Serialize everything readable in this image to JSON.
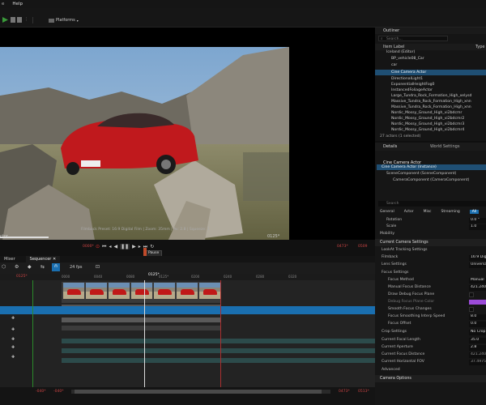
{
  "menu": {
    "help": "Help"
  },
  "toolbar": {
    "platforms_label": "Platforms"
  },
  "viewport": {
    "filmback_info": "Filmback Preset: 16:9 Digital Film | Zoom: 35mm | Av: 2.8 | Squeeze: 1",
    "actor_label": "ctor",
    "frame_readout": "0125*"
  },
  "transport": {
    "start_frame": "0000*",
    "end_frame": "0473*",
    "end_label": "0509",
    "tooltip": "Pause"
  },
  "sequencer": {
    "tab_mixer": "Mixer",
    "tab_sequencer": "Sequencer",
    "fps": "24 fps",
    "current_frame": "0125*",
    "playhead_label": "0125*",
    "start_label": "0000*",
    "bottom_left_a": "-040*",
    "bottom_left_b": "-040*",
    "bottom_right_a": "0473*",
    "bottom_right_b": "0513*",
    "time_labels": [
      "0000",
      "0040",
      "0080",
      "0125*",
      "0200",
      "0240",
      "0280",
      "0320"
    ]
  },
  "outliner": {
    "title": "Outliner",
    "search_placeholder": "Search...",
    "column_label": "Item Label",
    "column_type": "Type",
    "items": [
      "Iceland (Editor)",
      "BP_vehicle08_Car",
      "car",
      "Cine Camera Actor",
      "DirectionalLight1",
      "ExponentialHeightFog0",
      "InstancedFoliageActor",
      "Large_Tundra_Rock_Formation_High_xelysd",
      "Massive_Tundra_Rock_Formation_High_xnn",
      "Massive_Tundra_Rock_Formation_High_xnn",
      "Nordic_Mossy_Ground_High_vi2bdcmr",
      "Nordic_Mossy_Ground_High_vi2bdcmr2",
      "Nordic_Mossy_Ground_High_vi2bdcmr3",
      "Nordic_Mossy_Ground_High_vi2bdcmr4"
    ],
    "status": "27 actors (1 selected)"
  },
  "details": {
    "tab_details": "Details",
    "tab_world": "World Settings",
    "actor_name": "Cine Camera Actor",
    "instance_label": "Cine Camera Actor (Instance)",
    "scene_component": "SceneComponent (SceneComponent)",
    "camera_component": "CameraComponent (CameraComponent)",
    "search_placeholder": "Search",
    "filter_tabs": [
      "General",
      "Actor",
      "Misc",
      "Streaming",
      "All"
    ],
    "rotation_label": "Rotation",
    "rotation_value": "0.0 °",
    "scale_label": "Scale",
    "scale_value": "1.0",
    "mobility_label": "Mobility",
    "sections": {
      "current_camera": "Current Camera Settings",
      "lookat": "LookAt Tracking Settings",
      "filmback": "Filmback",
      "lens": "Lens Settings",
      "focus": "Focus Settings",
      "crop": "Crop Settings",
      "advanced": "Advanced",
      "options": "Camera Options"
    },
    "filmback_value": "16:9 Digital",
    "lens_value": "Universal Zo",
    "focus_method_label": "Focus Method",
    "focus_method_value": "Manual",
    "manual_focus_label": "Manual Focus Distance",
    "manual_focus_value": "421.24000",
    "draw_debug_label": "Draw Debug Focus Plane",
    "debug_color_label": "Debug Focus Plane Color",
    "smooth_focus_label": "Smooth Focus Changes",
    "focus_speed_label": "Focus Smoothing Interp Speed",
    "focus_speed_value": "8.0",
    "focus_offset_label": "Focus Offset",
    "focus_offset_value": "0.0",
    "crop_value": "No Crop",
    "focal_length_label": "Current Focal Length",
    "focal_length_value": "35.0",
    "aperture_label": "Current Aperture",
    "aperture_value": "2.8",
    "focus_distance_label": "Current Focus Distance",
    "focus_distance_value": "421.24000",
    "hfov_label": "Current Horizontal FOV",
    "hfov_value": "37.497559"
  },
  "colors": {
    "accent_blue": "#1a6fb0",
    "selection": "#1f4f74",
    "debug_plane": "#9b4bd8",
    "record_red": "#e03030"
  }
}
